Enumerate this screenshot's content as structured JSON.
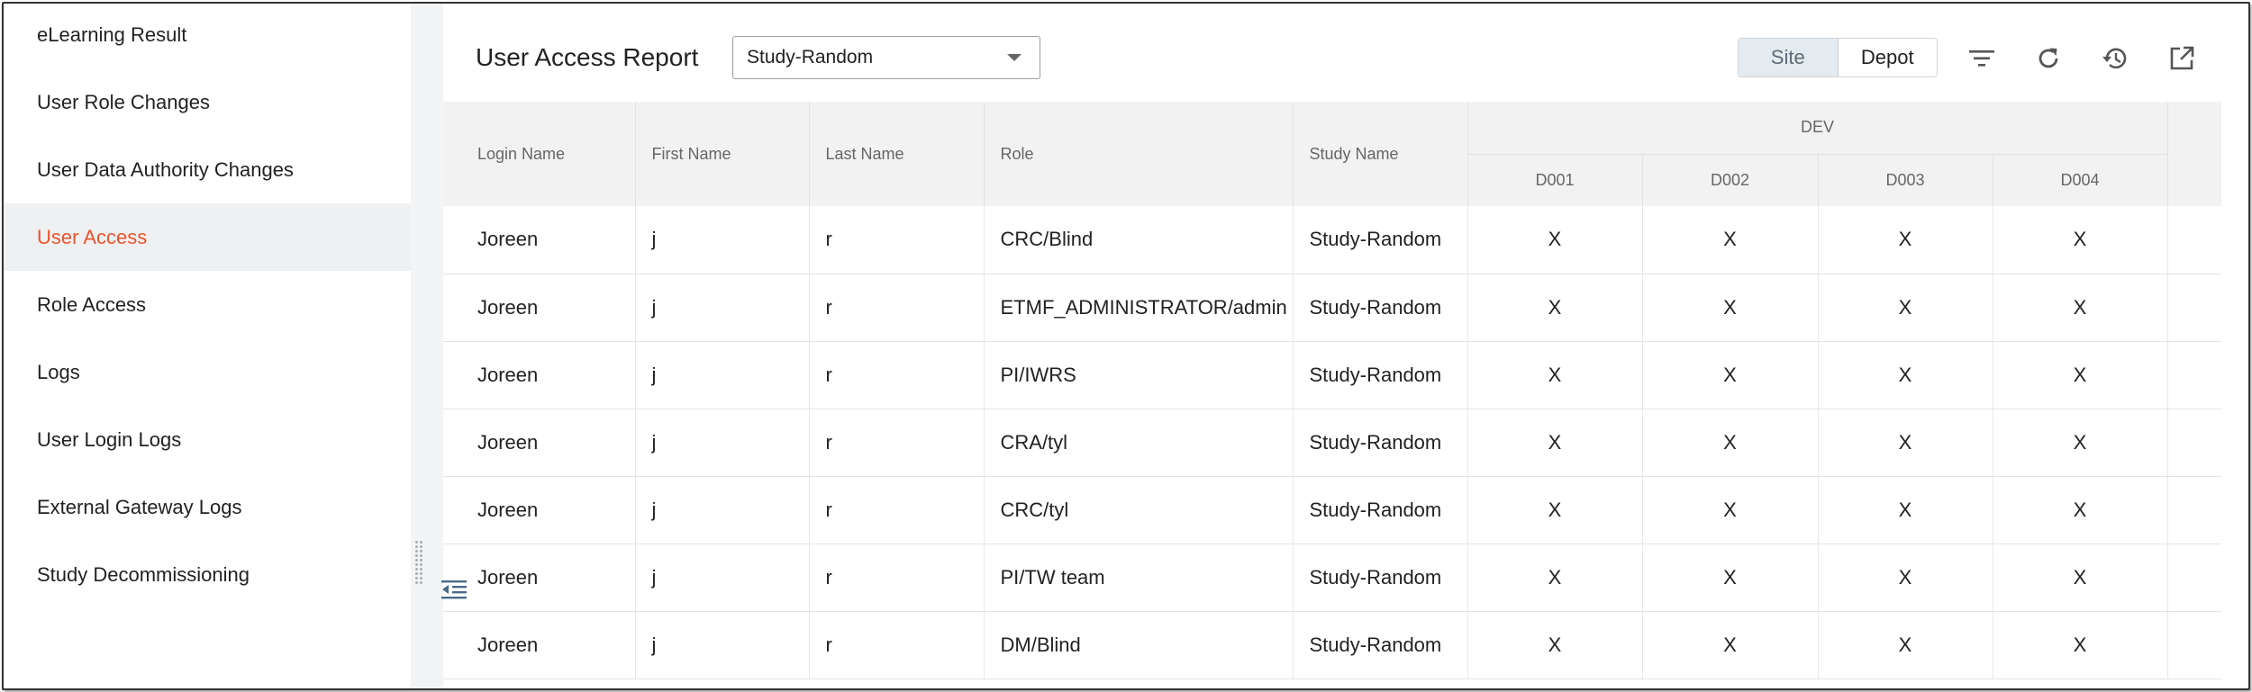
{
  "sidebar": {
    "items": [
      {
        "label": "eLearning Result"
      },
      {
        "label": "User Role Changes"
      },
      {
        "label": "User Data Authority Changes"
      },
      {
        "label": "User Access"
      },
      {
        "label": "Role Access"
      },
      {
        "label": "Logs"
      },
      {
        "label": "User Login Logs"
      },
      {
        "label": "External Gateway Logs"
      },
      {
        "label": "Study Decommissioning"
      }
    ],
    "active_index": 3
  },
  "header": {
    "title": "User Access Report",
    "study_select": {
      "value": "Study-Random"
    },
    "view_toggle": {
      "site_label": "Site",
      "depot_label": "Depot",
      "selected": "Site"
    },
    "icons": [
      "filter-icon",
      "refresh-icon",
      "history-icon",
      "open-external-icon"
    ]
  },
  "table": {
    "columns": {
      "login_name": "Login Name",
      "first_name": "First Name",
      "last_name": "Last Name",
      "role": "Role",
      "study_name": "Study Name",
      "group": "DEV",
      "sites": [
        "D001",
        "D002",
        "D003",
        "D004"
      ]
    },
    "rows": [
      {
        "login": "Joreen",
        "first": "j",
        "last": "r",
        "role": "CRC/Blind",
        "study": "Study-Random",
        "access": [
          "X",
          "X",
          "X",
          "X"
        ]
      },
      {
        "login": "Joreen",
        "first": "j",
        "last": "r",
        "role": "ETMF_ADMINISTRATOR/admin",
        "study": "Study-Random",
        "access": [
          "X",
          "X",
          "X",
          "X"
        ]
      },
      {
        "login": "Joreen",
        "first": "j",
        "last": "r",
        "role": "PI/IWRS",
        "study": "Study-Random",
        "access": [
          "X",
          "X",
          "X",
          "X"
        ]
      },
      {
        "login": "Joreen",
        "first": "j",
        "last": "r",
        "role": "CRA/tyl",
        "study": "Study-Random",
        "access": [
          "X",
          "X",
          "X",
          "X"
        ]
      },
      {
        "login": "Joreen",
        "first": "j",
        "last": "r",
        "role": "CRC/tyl",
        "study": "Study-Random",
        "access": [
          "X",
          "X",
          "X",
          "X"
        ]
      },
      {
        "login": "Joreen",
        "first": "j",
        "last": "r",
        "role": "PI/TW team",
        "study": "Study-Random",
        "access": [
          "X",
          "X",
          "X",
          "X"
        ]
      },
      {
        "login": "Joreen",
        "first": "j",
        "last": "r",
        "role": "DM/Blind",
        "study": "Study-Random",
        "access": [
          "X",
          "X",
          "X",
          "X"
        ]
      }
    ]
  },
  "colors": {
    "accent": "#e8552b",
    "active_bg": "#eef0f2",
    "header_bg": "#f2f2f2"
  }
}
